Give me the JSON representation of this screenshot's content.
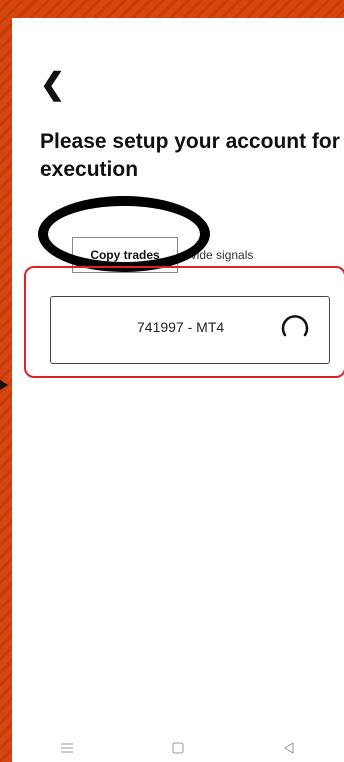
{
  "header": {
    "back_glyph": "❮",
    "title": "Please setup your account for execution"
  },
  "tabs": {
    "copy_trades": "Copy trades",
    "provide_signals_partial": "ovide signals"
  },
  "account": {
    "label": "741997 - MT4",
    "status_icon": "loading-spinner-icon"
  },
  "colors": {
    "annotation_red": "#e0202a",
    "background_orange": "#d7460f"
  },
  "navbar": {
    "menu_icon": "☰",
    "home_icon": "home-square-icon",
    "back_icon": "back-triangle-icon"
  }
}
